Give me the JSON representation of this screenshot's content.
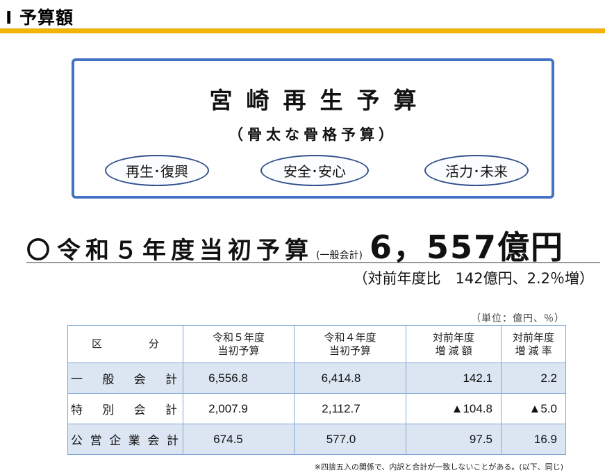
{
  "section": {
    "title": "Ⅰ 予算額"
  },
  "title_box": {
    "title": "宮崎再生予算",
    "subtitle": "（骨太な骨格予算）",
    "pillars": [
      "再生･復興",
      "安全･安心",
      "活力･未来"
    ]
  },
  "budget": {
    "circle": "〇",
    "label": "令和５年度当初予算",
    "note": "(一般会計)",
    "amount": "6，557億円"
  },
  "comparison": {
    "text": "（対前年度比　142億円、2.2％増）"
  },
  "table": {
    "unit": "（単位：億円、％）",
    "headers": [
      "区　分",
      "令和５年度\n当初予算",
      "令和４年度\n当初予算",
      "対前年度\n増 減 額",
      "対前年度\n増 減 率"
    ],
    "rows": [
      {
        "label": "一般会計",
        "values": [
          "6,556.8",
          "6,414.8",
          "142.1",
          "2.2"
        ]
      },
      {
        "label": "特別会計",
        "values": [
          "2,007.9",
          "2,112.7",
          "▲104.8",
          "▲5.0"
        ]
      },
      {
        "label": "公営企業会計",
        "values": [
          "674.5",
          "577.0",
          "97.5",
          "16.9"
        ]
      }
    ]
  },
  "footnote": "※四捨五入の関係で、内訳と合計が一致しないことがある。(以下、同じ)",
  "colors": {
    "accent_rule": "#f2b400",
    "box_border": "#4472c4",
    "table_shade": "#dce6f2"
  }
}
